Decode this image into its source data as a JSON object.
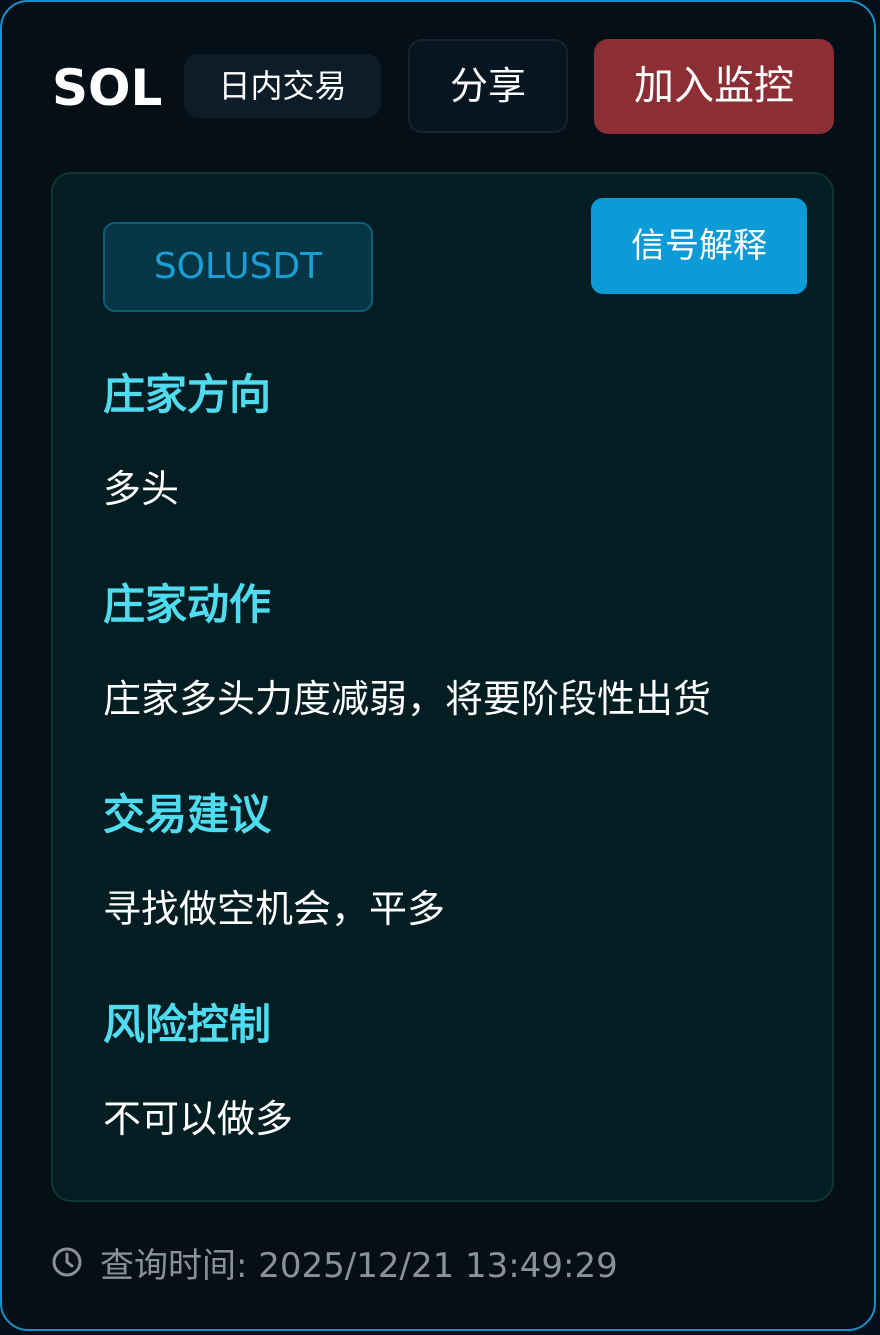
{
  "header": {
    "symbol": "SOL",
    "mode_badge": "日内交易",
    "share_label": "分享",
    "monitor_label": "加入监控"
  },
  "panel": {
    "pair": "SOLUSDT",
    "explain_label": "信号解释",
    "sections": [
      {
        "title": "庄家方向",
        "value": "多头"
      },
      {
        "title": "庄家动作",
        "value": "庄家多头力度减弱，将要阶段性出货"
      },
      {
        "title": "交易建议",
        "value": "寻找做空机会，平多"
      },
      {
        "title": "风险控制",
        "value": "不可以做多"
      }
    ]
  },
  "footer": {
    "query_time_label": "查询时间: 2025/12/21 13:49:29",
    "icon": "clock-icon"
  },
  "colors": {
    "accent_cyan": "#4fdcf0",
    "monitor_red": "#8b2f34",
    "explain_blue": "#0d9bd8",
    "border_blue": "#1b8fc7"
  }
}
